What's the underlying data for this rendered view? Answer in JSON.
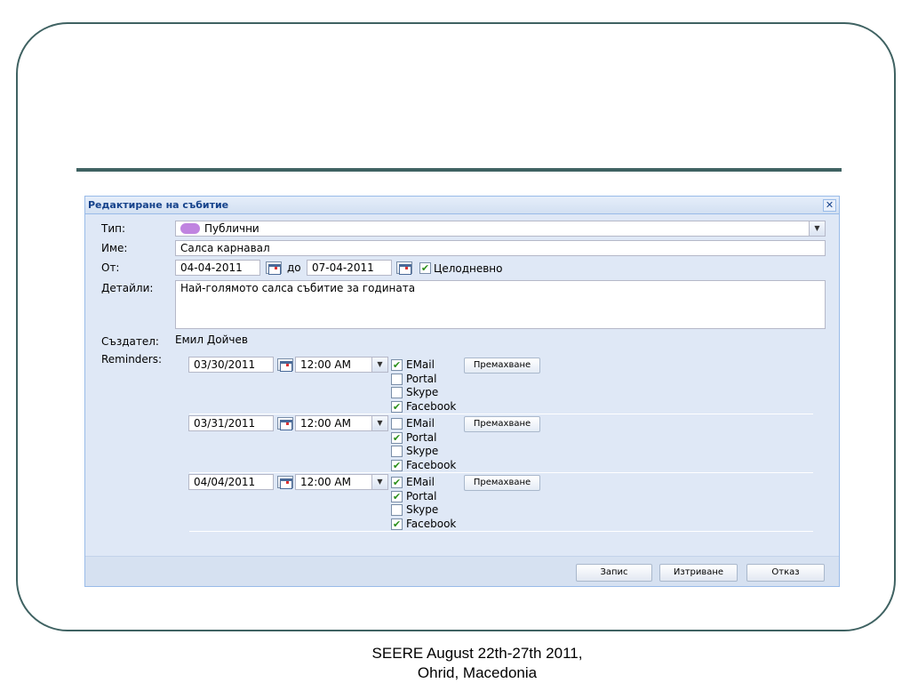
{
  "dialog": {
    "title": "Редактиране на събитие",
    "close_label": "✕",
    "type": {
      "label": "Тип:",
      "value": "Публични",
      "swatch_color": "#c084e0"
    },
    "name": {
      "label": "Име:",
      "value": "Салса карнавал"
    },
    "from": {
      "label": "От:",
      "start": "04-04-2011",
      "to_label": "до",
      "end": "07-04-2011",
      "allday_label": "Целодневно",
      "allday_checked": true
    },
    "details": {
      "label": "Детайли:",
      "value": "Най-голямото салса събитие за годината"
    },
    "creator": {
      "label": "Създател:",
      "value": "Емил Дойчев"
    },
    "reminders_label": "Reminders:",
    "reminders": [
      {
        "date": "03/30/2011",
        "time": "12:00 AM",
        "remove_label": "Премахване",
        "channels": [
          {
            "label": "EMail",
            "checked": true
          },
          {
            "label": "Portal",
            "checked": false
          },
          {
            "label": "Skype",
            "checked": false
          },
          {
            "label": "Facebook",
            "checked": true
          }
        ]
      },
      {
        "date": "03/31/2011",
        "time": "12:00 AM",
        "remove_label": "Премахване",
        "channels": [
          {
            "label": "EMail",
            "checked": false
          },
          {
            "label": "Portal",
            "checked": true
          },
          {
            "label": "Skype",
            "checked": false
          },
          {
            "label": "Facebook",
            "checked": true
          }
        ]
      },
      {
        "date": "04/04/2011",
        "time": "12:00 AM",
        "remove_label": "Премахване",
        "channels": [
          {
            "label": "EMail",
            "checked": true
          },
          {
            "label": "Portal",
            "checked": true
          },
          {
            "label": "Skype",
            "checked": false
          },
          {
            "label": "Facebook",
            "checked": true
          }
        ]
      }
    ],
    "buttons": {
      "save": "Запис",
      "delete": "Изтриване",
      "cancel": "Отказ"
    }
  },
  "footer": {
    "line1": "SEERE August 22th-27th 2011,",
    "line2": "Ohrid, Macedonia"
  },
  "check_mark": "✔"
}
